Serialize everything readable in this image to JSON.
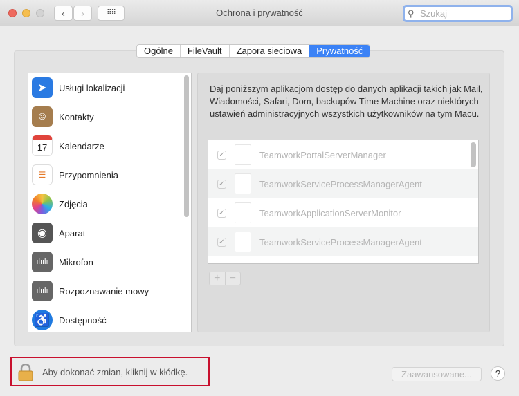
{
  "window": {
    "title": "Ochrona i prywatność",
    "search_placeholder": "Szukaj"
  },
  "tabs": [
    {
      "label": "Ogólne"
    },
    {
      "label": "FileVault"
    },
    {
      "label": "Zapora sieciowa"
    },
    {
      "label": "Prywatność",
      "active": true
    }
  ],
  "sidebar": {
    "items": [
      {
        "label": "Usługi lokalizacji",
        "icon": "location-icon"
      },
      {
        "label": "Kontakty",
        "icon": "contacts-icon"
      },
      {
        "label": "Kalendarze",
        "icon": "calendar-icon",
        "badge": "17"
      },
      {
        "label": "Przypomnienia",
        "icon": "reminders-icon"
      },
      {
        "label": "Zdjęcia",
        "icon": "photos-icon"
      },
      {
        "label": "Aparat",
        "icon": "camera-icon"
      },
      {
        "label": "Mikrofon",
        "icon": "microphone-icon"
      },
      {
        "label": "Rozpoznawanie mowy",
        "icon": "speech-recognition-icon"
      },
      {
        "label": "Dostępność",
        "icon": "accessibility-icon"
      }
    ]
  },
  "panel": {
    "description": "Daj poniższym aplikacjom dostęp do danych aplikacji takich jak Mail, Wiadomości, Safari, Dom, backupów Time Machine oraz niektórych ustawień administracyjnych wszystkich użytkowników na tym Macu.",
    "apps": [
      {
        "name": "TeamworkPortalServerManager",
        "checked": true
      },
      {
        "name": "TeamworkServiceProcessManagerAgent",
        "checked": true
      },
      {
        "name": "TeamworkApplicationServerMonitor",
        "checked": true
      },
      {
        "name": "TeamworkServiceProcessManagerAgent",
        "checked": true
      }
    ],
    "add_label": "+",
    "remove_label": "−"
  },
  "footer": {
    "lock_text": "Aby dokonać zmian, kliknij w kłódkę.",
    "advanced_label": "Zaawansowane...",
    "help_label": "?"
  }
}
